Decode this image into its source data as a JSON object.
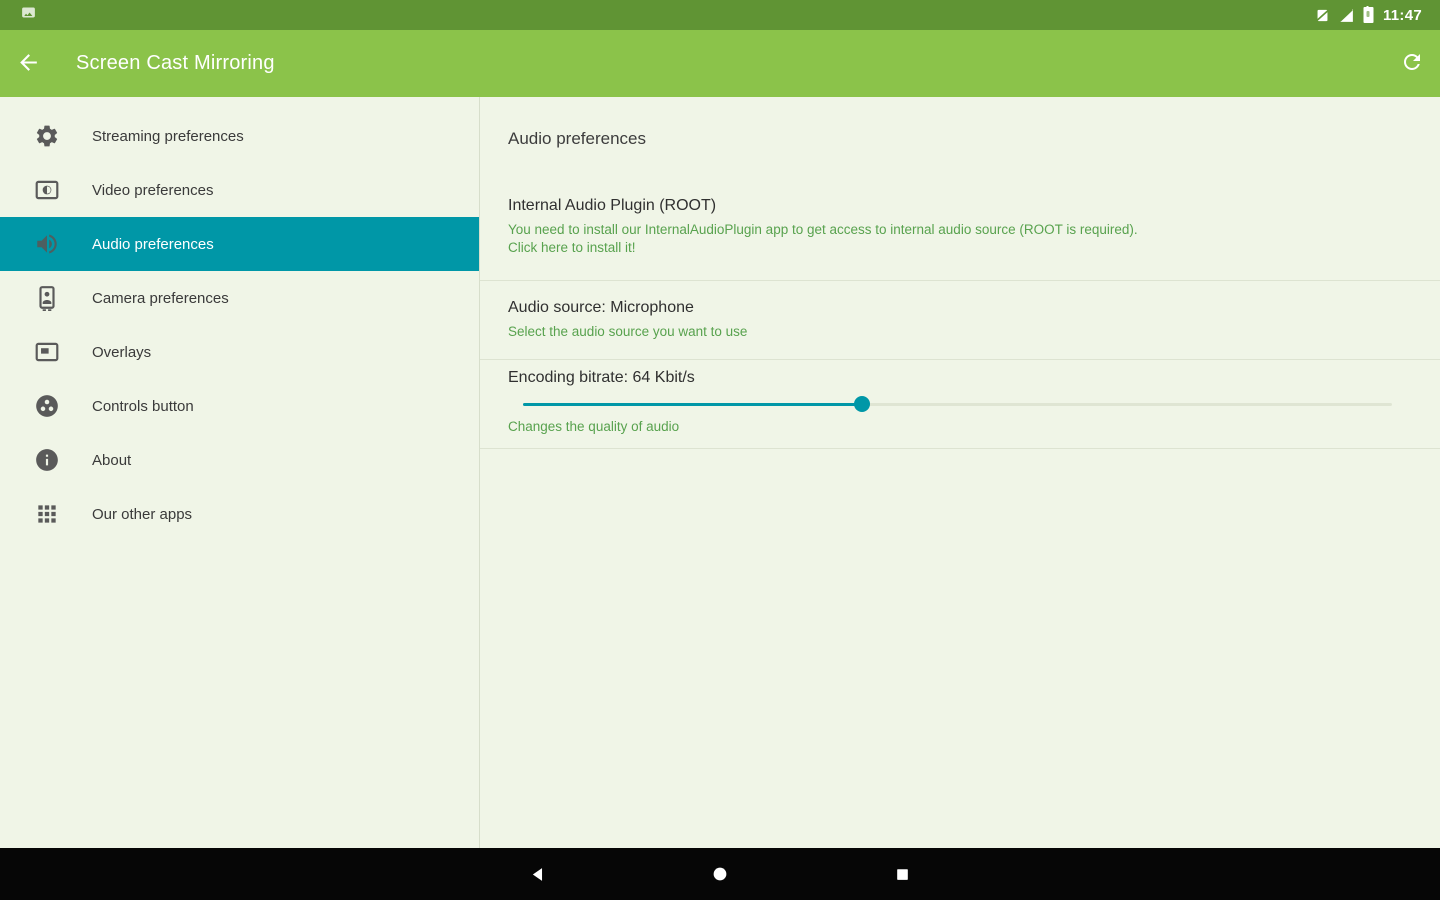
{
  "status_bar": {
    "time": "11:47",
    "left_icons": [
      {
        "name": "notification-icon"
      }
    ],
    "right_icons": [
      {
        "name": "no-sim-icon"
      },
      {
        "name": "no-signal-icon"
      },
      {
        "name": "battery-icon"
      }
    ]
  },
  "app_bar": {
    "title": "Screen Cast Mirroring"
  },
  "sidebar": {
    "items": [
      {
        "label": "Streaming preferences",
        "icon": "gear-icon",
        "selected": false
      },
      {
        "label": "Video preferences",
        "icon": "video-icon",
        "selected": false
      },
      {
        "label": "Audio preferences",
        "icon": "speaker-icon",
        "selected": true
      },
      {
        "label": "Camera preferences",
        "icon": "camera-icon",
        "selected": false
      },
      {
        "label": "Overlays",
        "icon": "overlay-icon",
        "selected": false
      },
      {
        "label": "Controls button",
        "icon": "controls-icon",
        "selected": false
      },
      {
        "label": "About",
        "icon": "info-icon",
        "selected": false
      },
      {
        "label": "Our other apps",
        "icon": "apps-grid-icon",
        "selected": false
      }
    ]
  },
  "main": {
    "header": "Audio preferences",
    "sections": [
      {
        "title": "Internal Audio Plugin (ROOT)",
        "summary": "You need to install our InternalAudioPlugin app to get access to internal audio source (ROOT is required).",
        "summary2": "Click here to install it!"
      },
      {
        "title": "Audio source: Microphone",
        "summary": "Select the audio source you want to use"
      },
      {
        "title": "Encoding bitrate: 64 Kbit/s",
        "summary": "Changes the quality of audio",
        "slider": {
          "percent": 39
        }
      }
    ]
  },
  "nav_bar": {
    "buttons": [
      {
        "name": "back"
      },
      {
        "name": "home"
      },
      {
        "name": "recents"
      }
    ]
  },
  "colors": {
    "status_bar": "#609434",
    "app_bar": "#8BC34A",
    "accent_teal": "#0097A7",
    "green_text": "#58A24E",
    "background": "#F0F5E7"
  }
}
